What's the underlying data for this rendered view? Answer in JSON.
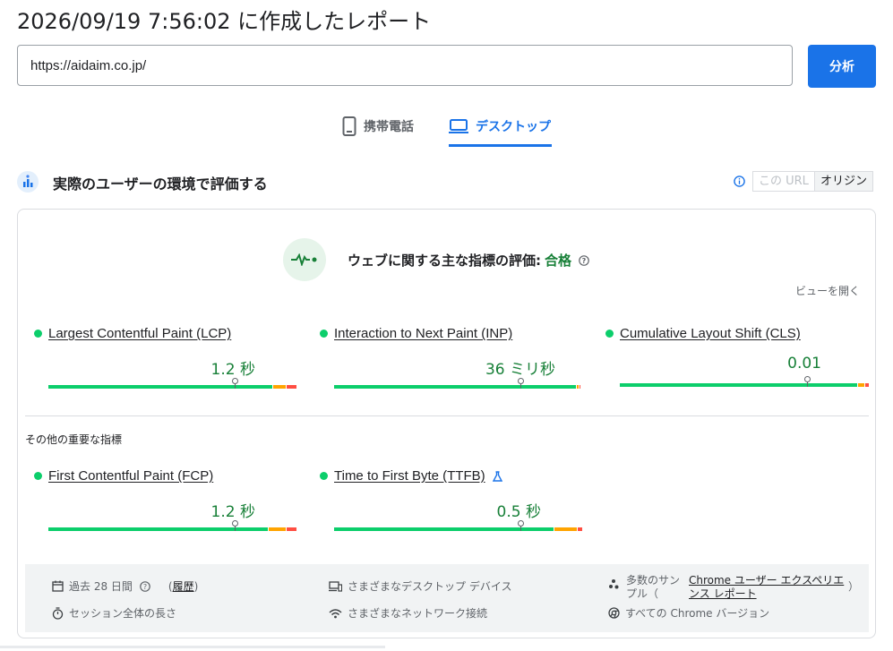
{
  "header": {
    "title": "2026/09/19 7:56:02 に作成したレポート"
  },
  "search": {
    "url_value": "https://aidaim.co.jp/",
    "analyze_label": "分析"
  },
  "tabs": [
    {
      "label": "携帯電話",
      "icon": "smartphone-icon",
      "active": false
    },
    {
      "label": "デスクトップ",
      "icon": "laptop-icon",
      "active": true
    }
  ],
  "field_section": {
    "title": "実際のユーザーの環境で評価する",
    "toggle": {
      "url_label": "この URL",
      "origin_label": "オリジン",
      "selected": "オリジン"
    }
  },
  "assessment": {
    "label": "ウェブに関する主な指標の評価:",
    "result": "合格",
    "expand_label": "ビューを開く"
  },
  "core_metrics": [
    {
      "name": "Largest Contentful Paint (LCP)",
      "value": "1.2 秒",
      "distribution": [
        0.91,
        0.05,
        0.04
      ]
    },
    {
      "name": "Interaction to Next Paint (INP)",
      "value": "36 ミリ秒",
      "distribution": [
        0.99,
        0.005,
        0.005
      ]
    },
    {
      "name": "Cumulative Layout Shift (CLS)",
      "value": "0.01",
      "distribution": [
        0.96,
        0.025,
        0.015
      ]
    }
  ],
  "other_section_title": "その他の重要な指標",
  "other_metrics": [
    {
      "name": "First Contentful Paint (FCP)",
      "value": "1.2 秒",
      "distribution": [
        0.89,
        0.07,
        0.04
      ],
      "experimental": false
    },
    {
      "name": "Time to First Byte (TTFB)",
      "value": "0.5 秒",
      "distribution": [
        0.89,
        0.09,
        0.02
      ],
      "experimental": true
    }
  ],
  "footer": {
    "period": "過去 28 日間",
    "history_link": "履歴",
    "devices": "さまざまなデスクトップ デバイス",
    "samples_prefix": "多数のサン",
    "samples_prefix2": "プル（",
    "samples_link_1": "Chrome ユーザー エクスペリエ",
    "samples_link_2": "ンス レポート",
    "samples_suffix": "）",
    "session": "セッション全体の長さ",
    "network": "さまざまなネットワーク接続",
    "versions": "すべての Chrome バージョン"
  },
  "colors": {
    "good": "#0cce6b",
    "needs_improvement": "#ffa400",
    "poor": "#ff4e42",
    "accent": "#1a73e8",
    "pass_text": "#188038"
  }
}
